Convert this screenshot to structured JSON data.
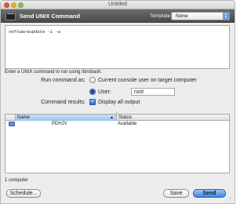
{
  "window": {
    "title": "Untitled"
  },
  "header": {
    "title": "Send UNIX Command",
    "template_label": "Template:",
    "template_value": "None"
  },
  "command": {
    "text": "softwareupdate -i -a",
    "hint": "Enter a UNIX command to run using /bin/bash."
  },
  "run_as": {
    "label": "Run command as:",
    "option_console": "Current console user on target computer",
    "option_user": "User:",
    "user_value": "root",
    "selected": "User"
  },
  "results": {
    "label": "Command results:",
    "display_all_label": "Display all output",
    "display_all_checked": true
  },
  "table": {
    "columns": [
      "Name",
      "Status"
    ],
    "rows": [
      {
        "name": "PDHJV",
        "status": "Available"
      }
    ]
  },
  "footer": {
    "count": "1 computer",
    "schedule_label": "Schedule...",
    "save_label": "Save",
    "send_label": "Send"
  },
  "colors": {
    "accent": "#3f84df",
    "header_bg": "#5a5a5a"
  }
}
